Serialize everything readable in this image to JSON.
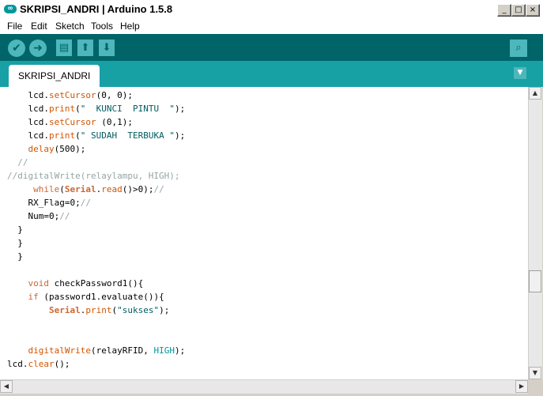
{
  "window": {
    "title": "SKRIPSI_ANDRI | Arduino 1.5.8",
    "controls": {
      "minimize": "_",
      "maximize": "□",
      "close": "×"
    }
  },
  "menu": [
    "File",
    "Edit",
    "Sketch",
    "Tools",
    "Help"
  ],
  "toolbar": {
    "verify_icon": "check-icon",
    "upload_icon": "arrow-right-icon",
    "new_icon": "page-icon",
    "open_icon": "arrow-up-icon",
    "save_icon": "arrow-down-icon",
    "serial_monitor_icon": "magnifier-icon"
  },
  "tabs": [
    {
      "label": "SKRIPSI_ANDRI",
      "active": true
    }
  ],
  "editor": {
    "lines": [
      [
        [
          "    lcd.",
          ""
        ],
        [
          "setCursor",
          "fn"
        ],
        [
          "(0, 0);",
          ""
        ]
      ],
      [
        [
          "    lcd.",
          ""
        ],
        [
          "print",
          "fn"
        ],
        [
          "(",
          ""
        ],
        [
          "\"  KUNCI  PINTU  \"",
          "str"
        ],
        [
          ");",
          ""
        ]
      ],
      [
        [
          "    lcd.",
          ""
        ],
        [
          "setCursor",
          "fn"
        ],
        [
          " (0,1);",
          ""
        ]
      ],
      [
        [
          "    lcd.",
          ""
        ],
        [
          "print",
          "fn"
        ],
        [
          "(",
          ""
        ],
        [
          "\" SUDAH  TERBUKA \"",
          "str"
        ],
        [
          ");",
          ""
        ]
      ],
      [
        [
          "    ",
          ""
        ],
        [
          "delay",
          "fn"
        ],
        [
          "(500);",
          ""
        ]
      ],
      [
        [
          "  //",
          "cmt"
        ]
      ],
      [
        [
          "//digitalWrite(relaylampu, HIGH);",
          "cmt"
        ]
      ],
      [
        [
          "     ",
          ""
        ],
        [
          "while",
          "kw"
        ],
        [
          "(",
          ""
        ],
        [
          "Serial",
          "cls"
        ],
        [
          ".",
          ""
        ],
        [
          "read",
          "fn"
        ],
        [
          "()>0);",
          ""
        ],
        [
          "//",
          "cmt"
        ]
      ],
      [
        [
          "    RX_Flag=0;",
          ""
        ],
        [
          "//",
          "cmt"
        ]
      ],
      [
        [
          "    Num=0;",
          ""
        ],
        [
          "//",
          "cmt"
        ]
      ],
      [
        [
          "  }",
          ""
        ]
      ],
      [
        [
          "  }",
          ""
        ]
      ],
      [
        [
          "  }",
          ""
        ]
      ],
      [
        [
          "",
          ""
        ]
      ],
      [
        [
          "    ",
          ""
        ],
        [
          "void",
          "kw"
        ],
        [
          " checkPassword1(){",
          ""
        ]
      ],
      [
        [
          "    ",
          ""
        ],
        [
          "if",
          "kw"
        ],
        [
          " (password1.evaluate()){",
          ""
        ]
      ],
      [
        [
          "        ",
          ""
        ],
        [
          "Serial",
          "cls"
        ],
        [
          ".",
          ""
        ],
        [
          "print",
          "fn"
        ],
        [
          "(",
          ""
        ],
        [
          "\"sukses\"",
          "str"
        ],
        [
          ");",
          ""
        ]
      ],
      [
        [
          "",
          ""
        ]
      ],
      [
        [
          "",
          ""
        ]
      ],
      [
        [
          "    ",
          ""
        ],
        [
          "digitalWrite",
          "fn"
        ],
        [
          "(relayRFID, ",
          ""
        ],
        [
          "HIGH",
          "const"
        ],
        [
          ");",
          ""
        ]
      ],
      [
        [
          "lcd.",
          ""
        ],
        [
          "clear",
          "fn"
        ],
        [
          "();",
          ""
        ]
      ]
    ]
  },
  "scroll": {
    "vertical_position": 0.67
  }
}
